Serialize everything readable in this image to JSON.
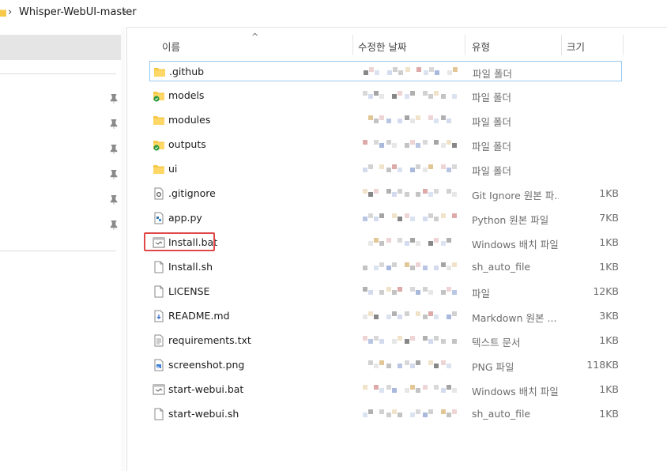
{
  "breadcrumb": {
    "current": "Whisper-WebUI-master",
    "separator": "›"
  },
  "header": {
    "name": "이름",
    "date": "수정한 날짜",
    "type": "유형",
    "size": "크기",
    "sort_caret": "^"
  },
  "files": [
    {
      "name": ".github",
      "type": "파일 폴더",
      "size": "",
      "icon": "folder-icon"
    },
    {
      "name": "models",
      "type": "파일 폴더",
      "size": "",
      "icon": "folder-synced-icon"
    },
    {
      "name": "modules",
      "type": "파일 폴더",
      "size": "",
      "icon": "folder-icon"
    },
    {
      "name": "outputs",
      "type": "파일 폴더",
      "size": "",
      "icon": "folder-synced-icon"
    },
    {
      "name": "ui",
      "type": "파일 폴더",
      "size": "",
      "icon": "folder-icon"
    },
    {
      "name": ".gitignore",
      "type": "Git Ignore 원본 파...",
      "size": "1KB",
      "icon": "gear-file-icon"
    },
    {
      "name": "app.py",
      "type": "Python 원본 파일",
      "size": "7KB",
      "icon": "python-file-icon"
    },
    {
      "name": "Install.bat",
      "type": "Windows 배치 파일",
      "size": "1KB",
      "icon": "batch-file-icon"
    },
    {
      "name": "Install.sh",
      "type": "sh_auto_file",
      "size": "1KB",
      "icon": "blank-file-icon"
    },
    {
      "name": "LICENSE",
      "type": "파일",
      "size": "12KB",
      "icon": "blank-file-icon"
    },
    {
      "name": "README.md",
      "type": "Markdown 원본 ...",
      "size": "3KB",
      "icon": "markdown-file-icon"
    },
    {
      "name": "requirements.txt",
      "type": "텍스트 문서",
      "size": "1KB",
      "icon": "text-file-icon"
    },
    {
      "name": "screenshot.png",
      "type": "PNG 파일",
      "size": "118KB",
      "icon": "image-file-icon"
    },
    {
      "name": "start-webui.bat",
      "type": "Windows 배치 파일",
      "size": "1KB",
      "icon": "batch-file-icon"
    },
    {
      "name": "start-webui.sh",
      "type": "sh_auto_file",
      "size": "1KB",
      "icon": "blank-file-icon"
    }
  ],
  "colors": {
    "folder": "#f7c948",
    "selection_border": "#99c9ef",
    "highlight": "#e04848",
    "sync_badge": "#2e9a3e"
  }
}
